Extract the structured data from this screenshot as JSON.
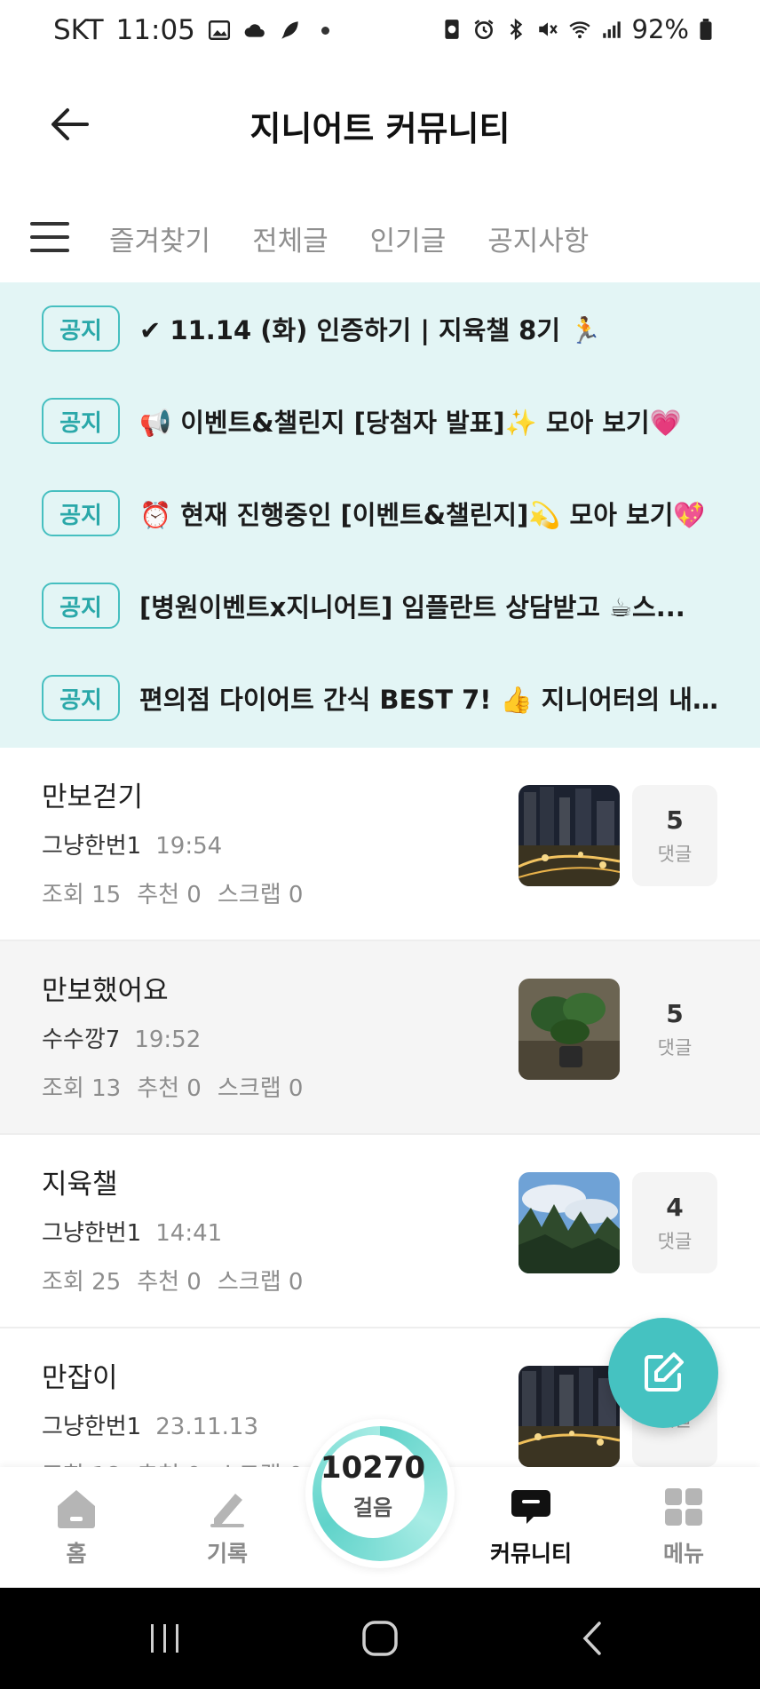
{
  "status_bar": {
    "carrier": "SKT",
    "time": "11:05",
    "battery": "92%"
  },
  "header": {
    "title": "지니어트 커뮤니티"
  },
  "tabs": [
    {
      "label": "즐겨찾기"
    },
    {
      "label": "전체글"
    },
    {
      "label": "인기글"
    },
    {
      "label": "공지사항"
    }
  ],
  "notices": [
    {
      "badge": "공지",
      "text": "✔ 11.14 (화) 인증하기 | 지육챌 8기 🏃"
    },
    {
      "badge": "공지",
      "text": "📢 이벤트&챌린지 [당첨자 발표]✨ 모아 보기💗"
    },
    {
      "badge": "공지",
      "text": "⏰ 현재 진행중인 [이벤트&챌린지]💫 모아 보기💖"
    },
    {
      "badge": "공지",
      "text": "[병원이벤트x지니어트] 임플란트 상담받고 ☕스..."
    },
    {
      "badge": "공지",
      "text": "편의점 다이어트 간식 BEST 7! 👍 지니어터의 내..."
    }
  ],
  "posts": [
    {
      "title": "만보걷기",
      "author": "그냥한번1",
      "time": "19:54",
      "views": "조회 15",
      "likes": "추천 0",
      "scraps": "스크랩 0",
      "comments": "5",
      "comments_label": "댓글"
    },
    {
      "title": "만보했어요",
      "author": "수수깡7",
      "time": "19:52",
      "views": "조회 13",
      "likes": "추천 0",
      "scraps": "스크랩 0",
      "comments": "5",
      "comments_label": "댓글"
    },
    {
      "title": "지육챌",
      "author": "그냥한번1",
      "time": "14:41",
      "views": "조회 25",
      "likes": "추천 0",
      "scraps": "스크랩 0",
      "comments": "4",
      "comments_label": "댓글"
    },
    {
      "title": "만잡이",
      "author": "그냥한번1",
      "time": "23.11.13",
      "views": "조회 18",
      "likes": "추천 0",
      "scraps": "스크랩 0",
      "comments": "",
      "comments_label": "댓글"
    }
  ],
  "bottom_nav": {
    "home": "홈",
    "record": "기록",
    "steps_value": "10270",
    "steps_label": "걸음",
    "community": "커뮤니티",
    "menu": "메뉴"
  },
  "colors": {
    "accent": "#45c2c1",
    "notice_bg": "#e3f5f5",
    "badge_border": "#46bfc0"
  },
  "icons": {
    "back": "arrow-left-icon",
    "menu": "hamburger-icon",
    "fab": "pencil-edit-icon",
    "home": "home-icon",
    "record": "pencil-icon",
    "community": "chat-bubble-icon",
    "menu_grid": "grid-icon"
  }
}
